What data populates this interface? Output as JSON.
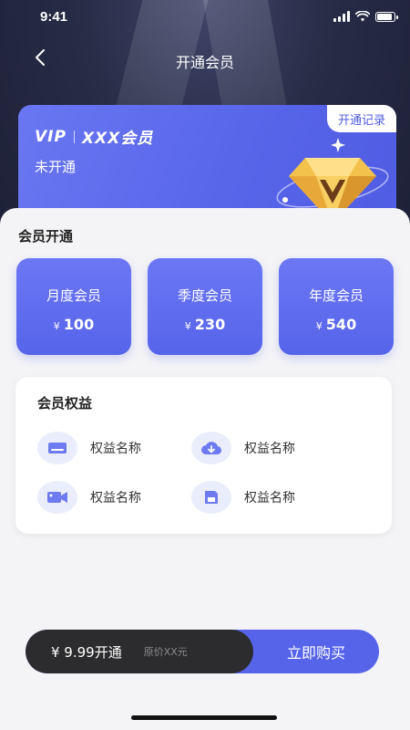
{
  "status_bar": {
    "time": "9:41"
  },
  "nav": {
    "title": "开通会员",
    "back_icon": "chevron-left-icon"
  },
  "vip_card": {
    "logo_text": "VIP",
    "brand": "XXX会员",
    "status": "未开通",
    "record_button": "开通记录",
    "badge_icon": "diamond-v-icon"
  },
  "plans_section": {
    "title": "会员开通",
    "currency": "¥",
    "plans": [
      {
        "name": "月度会员",
        "price": "100"
      },
      {
        "name": "季度会员",
        "price": "230"
      },
      {
        "name": "年度会员",
        "price": "540"
      }
    ]
  },
  "benefits": {
    "title": "会员权益",
    "items": [
      {
        "label": "权益名称",
        "icon": "drive-icon"
      },
      {
        "label": "权益名称",
        "icon": "cloud-download-icon"
      },
      {
        "label": "权益名称",
        "icon": "video-camera-icon"
      },
      {
        "label": "权益名称",
        "icon": "save-disk-icon"
      }
    ]
  },
  "buy_bar": {
    "price_label": "¥ 9.99开通",
    "original_price": "原价XX元",
    "buy_button": "立即购买"
  },
  "colors": {
    "accent": "#5664ea",
    "dark": "#2c2c2e",
    "hero_bg": "#272b45",
    "sheet_bg": "#f4f4f6"
  }
}
